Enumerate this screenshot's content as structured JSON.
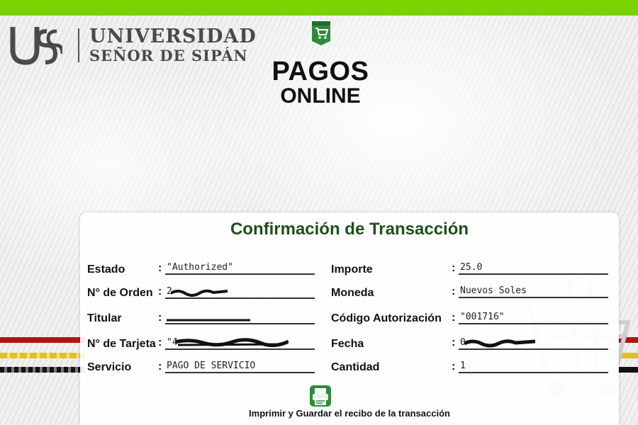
{
  "header": {
    "logo_text_line1": "UNIVERSIDAD",
    "logo_text_line2": "SEÑOR DE SIPÁN",
    "title_line1": "PAGOS",
    "title_line2": "ONLINE"
  },
  "card": {
    "title": "Confirmación de Transacción",
    "left_fields": [
      {
        "label": "Estado",
        "value": "\"Authorized\"",
        "redacted": false
      },
      {
        "label": "N° de Orden",
        "value": "2",
        "redacted": true
      },
      {
        "label": "Titular",
        "value": "",
        "redacted": true
      },
      {
        "label": "N° de Tarjeta",
        "value": "\"4",
        "redacted": true
      },
      {
        "label": "Servicio",
        "value": "PAGO DE SERVICIO",
        "redacted": false
      }
    ],
    "right_fields": [
      {
        "label": "Importe",
        "value": "25.0",
        "redacted": false
      },
      {
        "label": "Moneda",
        "value": "Nuevos Soles",
        "redacted": false
      },
      {
        "label": "Código Autorización",
        "value": "\"001716\"",
        "redacted": false
      },
      {
        "label": "Fecha",
        "value": "0",
        "redacted": true
      },
      {
        "label": "Cantidad",
        "value": "1",
        "redacted": false
      }
    ],
    "colon": ":",
    "print_label": "Imprimir y Guardar el recibo de la transacción"
  },
  "colors": {
    "top_bar": "#78d300",
    "card_title": "#1f4f1f",
    "icon_green": "#2e8b3a"
  },
  "icons": {
    "logo": "uss-logo-mark",
    "badge": "shopping-cart-icon",
    "print": "printer-icon",
    "background": "shopping-cart-icon"
  }
}
